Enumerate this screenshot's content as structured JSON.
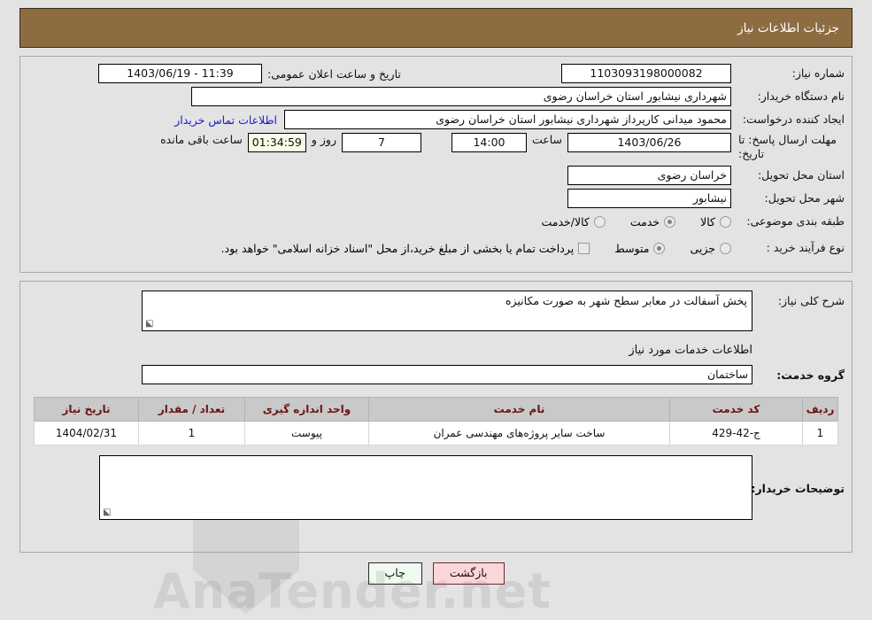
{
  "header": {
    "title": "جزئیات اطلاعات نیاز"
  },
  "watermark": {
    "text": "AnaTender.net"
  },
  "top_section": {
    "need_number": {
      "label": "شماره نیاز:",
      "value": "1103093198000082"
    },
    "public_announce": {
      "label": "تاریخ و ساعت اعلان عمومی:",
      "value": "11:39 - 1403/06/19"
    },
    "buyer_org": {
      "label": "نام دستگاه خریدار:",
      "value": "شهرداری نیشابور استان خراسان رضوی"
    },
    "requester": {
      "label": "ایجاد کننده درخواست:",
      "value": "محمود میدانی کارپرداز شهرداری نیشابور استان خراسان رضوی"
    },
    "contact_link": "اطلاعات تماس خریدار",
    "deadline": {
      "label_line1": "مهلت ارسال پاسخ: تا",
      "label_line2": "تاریخ:",
      "date": "1403/06/26",
      "time_word": "ساعت",
      "time": "14:00",
      "days": "7",
      "days_word": "روز و",
      "countdown": "01:34:59",
      "remaining_word": "ساعت باقی مانده"
    },
    "delivery_province": {
      "label": "استان محل تحویل:",
      "value": "خراسان رضوی"
    },
    "delivery_city": {
      "label": "شهر محل تحویل:",
      "value": "نیشابور"
    },
    "subject_class": {
      "label": "طبقه بندی موضوعی:",
      "options": [
        {
          "label": "کالا",
          "selected": false
        },
        {
          "label": "خدمت",
          "selected": true
        },
        {
          "label": "کالا/خدمت",
          "selected": false
        }
      ]
    },
    "purchase_type": {
      "label": "نوع فرآیند خرید :",
      "options": [
        {
          "label": "جزیی",
          "selected": false
        },
        {
          "label": "متوسط",
          "selected": true
        }
      ],
      "checkbox": {
        "label": "پرداخت تمام یا بخشی از مبلغ خرید،از محل \"اسناد خزانه اسلامی\" خواهد بود.",
        "checked": false
      }
    }
  },
  "mid_section": {
    "general_desc": {
      "label": "شرح کلی نیاز:",
      "value": "پخش آسفالت در معابر سطح شهر به صورت مکانیزه"
    },
    "services_heading": "اطلاعات خدمات مورد نیاز",
    "service_group": {
      "label": "گروه خدمت:",
      "value": "ساختمان"
    },
    "table": {
      "columns": [
        "ردیف",
        "کد خدمت",
        "نام خدمت",
        "واحد اندازه گیری",
        "تعداد / مقدار",
        "تاریخ نیاز"
      ],
      "rows": [
        {
          "index": "1",
          "service_code": "ج-42-429",
          "service_name": "ساخت سایر پروژه‌های مهندسی عمران",
          "unit": "پیوست",
          "quantity": "1",
          "need_date": "1404/02/31"
        }
      ]
    },
    "buyer_notes": {
      "label": "توضیحات خریدار:",
      "value": ""
    }
  },
  "buttons": {
    "back": "بازگشت",
    "print": "چاپ"
  },
  "colors": {
    "header_brown": "#8d6c41",
    "page_bg": "#e3e3e3",
    "link_blue": "#1a1ad0",
    "table_header_bg": "#c9c9c9",
    "table_header_text": "#6a1414",
    "back_btn_bg": "#fad6da",
    "print_btn_bg": "#effbef",
    "countdown_bg": "#fbfbe8"
  }
}
